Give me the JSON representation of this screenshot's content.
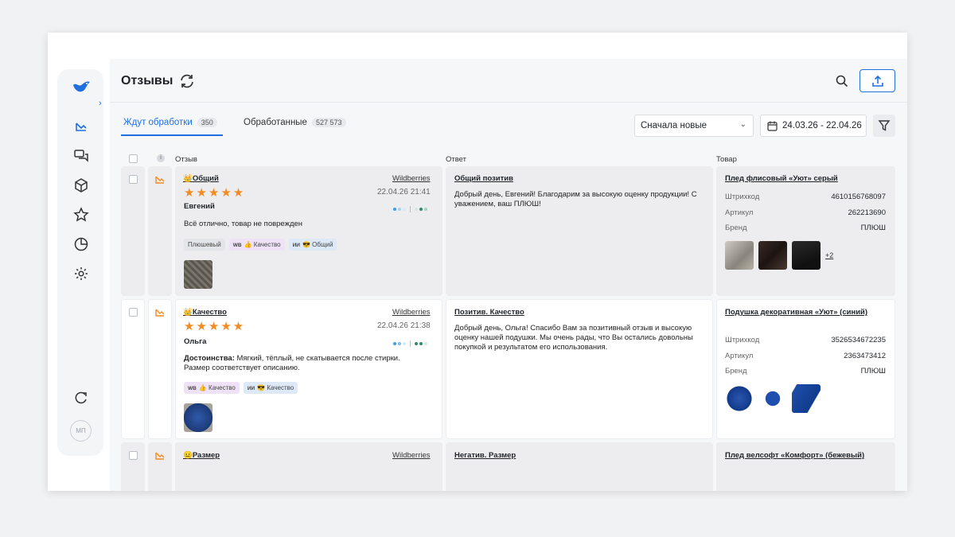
{
  "app": {
    "title": "Отзывы",
    "avatar_initials": "МП",
    "brand_color": "#1f6fe0"
  },
  "sidebar": {
    "items": [
      {
        "icon": "reviews-icon",
        "active": true
      },
      {
        "icon": "chat-icon"
      },
      {
        "icon": "box-icon"
      },
      {
        "icon": "star-icon"
      },
      {
        "icon": "pie-chart-icon"
      },
      {
        "icon": "gear-icon"
      },
      {
        "icon": "sync-icon"
      }
    ]
  },
  "tabs": [
    {
      "label": "Ждут обработки",
      "count": "350",
      "active": true
    },
    {
      "label": "Обработанные",
      "count": "527 573",
      "active": false
    }
  ],
  "controls": {
    "sort_value": "Сначала новые",
    "date_range": "24.03.26 - 22.04.26"
  },
  "columns": {
    "review": "Отзыв",
    "answer": "Ответ",
    "product": "Товар"
  },
  "rows": [
    {
      "category": "Общий",
      "marketplace": "Wildberries",
      "rating": 5,
      "date": "22.04.26 21:41",
      "author": "Евгений",
      "text_label": "",
      "text": "Всё отлично, товар не поврежден",
      "tags": [
        {
          "prefix": "",
          "label": "Плюшевый"
        },
        {
          "prefix": "WB",
          "label": "👍 Качество"
        },
        {
          "prefix": "ИИ",
          "label": "😎 Общий"
        }
      ],
      "answer_title": "Общий позитив",
      "answer_text": "Добрый день, Евгений! Благодарим за высокую оценку продукции! С уважением, ваш ПЛЮШ!",
      "product_title": "Плед флисовый «Уют» серый",
      "barcode_label": "Штрихкод",
      "barcode": "4610156768097",
      "article_label": "Артикул",
      "article": "262213690",
      "brand_label": "Бренд",
      "brand": "ПЛЮШ",
      "more_images": "+2"
    },
    {
      "category": "Качество",
      "marketplace": "Wildberries",
      "rating": 5,
      "date": "22.04.26 21:38",
      "author": "Ольга",
      "text_label": "Достоинства:",
      "text": " Мягкий, тёплый, не скатывается после стирки. Размер соответствует описанию.",
      "tags": [
        {
          "prefix": "WB",
          "label": "👍 Качество"
        },
        {
          "prefix": "ИИ",
          "label": "😎 Качество"
        }
      ],
      "answer_title": "Позитив. Качество",
      "answer_text": "Добрый день, Ольга! Спасибо Вам за позитивный отзыв и высокую оценку нашей подушки. Мы очень рады, что Вы остались довольны покупкой и результатом его использования.",
      "product_title": "Подушка декоративная «Уют» (синий)",
      "barcode_label": "Штрихкод",
      "barcode": "3526534672235",
      "article_label": "Артикул",
      "article": "2363473412",
      "brand_label": "Бренд",
      "brand": "ПЛЮШ"
    },
    {
      "category": "Размер",
      "marketplace": "Wildberries",
      "answer_title": "Негатив. Размер",
      "product_title": "Плед велсофт «Комфорт» (бежевый)"
    }
  ]
}
